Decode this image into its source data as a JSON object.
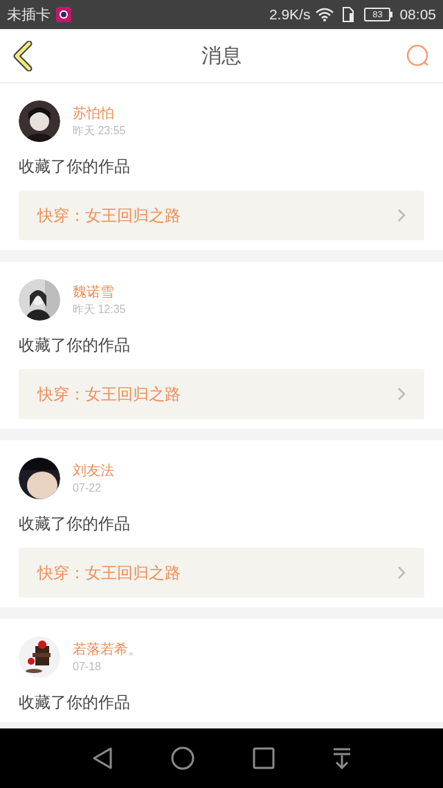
{
  "status_bar": {
    "carrier": "未插卡",
    "speed": "2.9K/s",
    "battery": "83",
    "time": "08:05"
  },
  "header": {
    "title": "消息"
  },
  "messages": [
    {
      "user": "苏怕怕",
      "time": "昨天 23:55",
      "action": "收藏了你的作品",
      "work": "快穿：女王回归之路"
    },
    {
      "user": "魏诺雪",
      "time": "昨天 12:35",
      "action": "收藏了你的作品",
      "work": "快穿：女王回归之路"
    },
    {
      "user": "刘友法",
      "time": "07-22",
      "action": "收藏了你的作品",
      "work": "快穿：女王回归之路"
    },
    {
      "user": "若落若希。",
      "time": "07-18",
      "action": "收藏了你的作品"
    }
  ]
}
